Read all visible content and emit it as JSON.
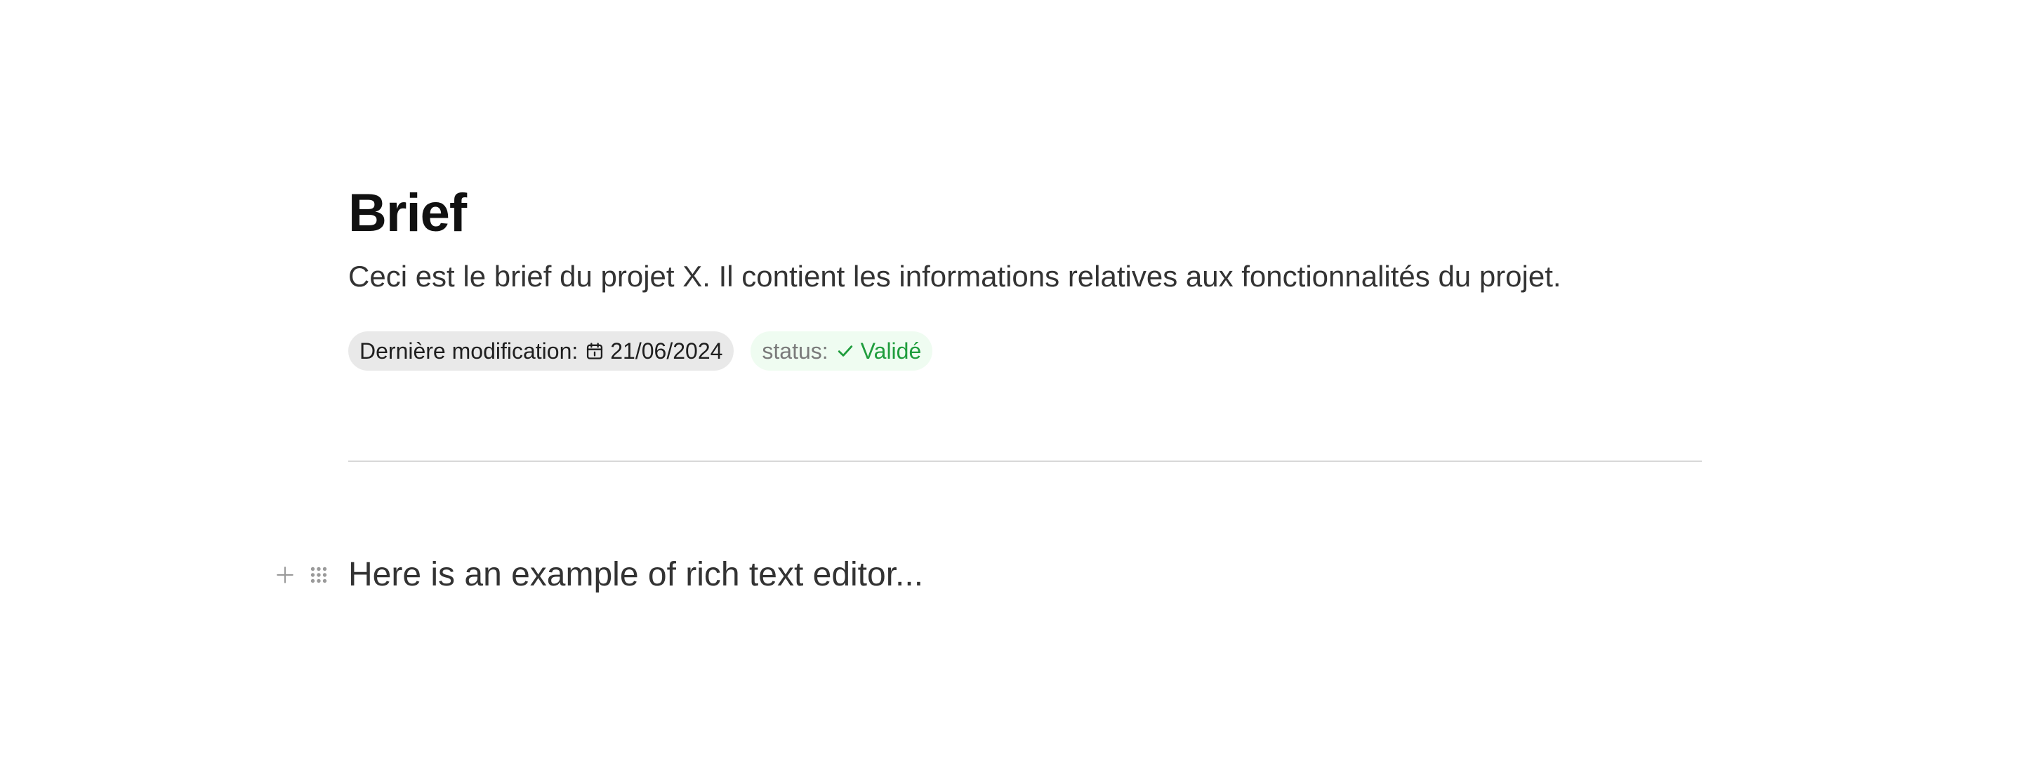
{
  "document": {
    "title": "Brief",
    "description": "Ceci est le brief du projet X. Il contient les informations relatives aux fonctionnalités du projet.",
    "meta": {
      "last_modified_label": "Dernière modification:",
      "last_modified_icon": "calendar-icon",
      "last_modified_date": "21/06/2024",
      "status_label": "status:",
      "status_icon": "check-icon",
      "status_value": "Validé",
      "status_color": "#1f9d3d",
      "status_bg": "#effcf1"
    }
  },
  "editor": {
    "block_controls": {
      "add_icon": "plus-icon",
      "drag_icon": "drag-handle-icon"
    },
    "content": "Here is an example of rich text editor..."
  }
}
